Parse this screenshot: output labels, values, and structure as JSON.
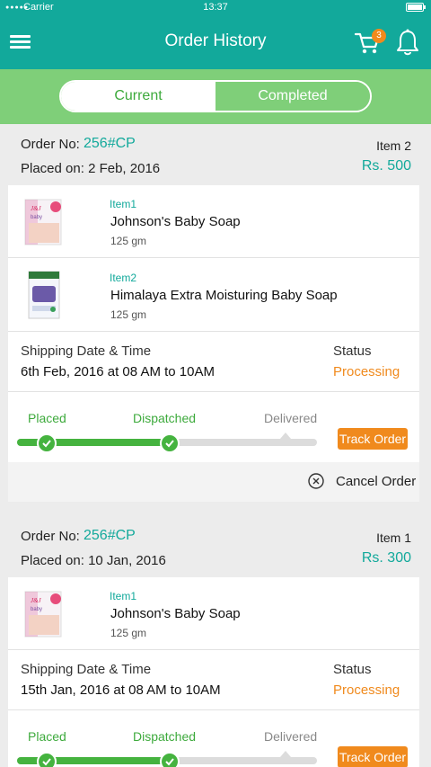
{
  "status_bar": {
    "carrier": "Carrier",
    "time": "13:37"
  },
  "app_bar": {
    "title": "Order History",
    "cart_count": "3"
  },
  "tabs": {
    "current": "Current",
    "completed": "Completed"
  },
  "colors": {
    "primary": "#12a99b",
    "green": "#45b33f",
    "orange": "#f08a1d",
    "tab_bg": "#7fcf79"
  },
  "labels": {
    "order_no": "Order No:",
    "placed_on": "Placed on:",
    "shipping": "Shipping Date & Time",
    "status": "Status",
    "track_order": "Track Order",
    "cancel_order": "Cancel Order",
    "step_placed": "Placed",
    "step_dispatched": "Dispatched",
    "step_delivered": "Delivered"
  },
  "orders": [
    {
      "order_no": "256#CP",
      "placed_date": "2 Feb, 2016",
      "item_count": "Item 2",
      "price": "Rs. 500",
      "items": [
        {
          "label": "Item1",
          "name": "Johnson's Baby Soap",
          "qty": "125 gm",
          "icon": "johnsons-baby-soap"
        },
        {
          "label": "Item2",
          "name": "Himalaya Extra Moisturing Baby Soap",
          "qty": "125 gm",
          "icon": "himalaya-baby-soap"
        }
      ],
      "shipping": "6th Feb, 2016 at 08 AM to 10AM",
      "status": "Processing",
      "steps_completed": 2
    },
    {
      "order_no": "256#CP",
      "placed_date": "10 Jan, 2016",
      "item_count": "Item 1",
      "price": "Rs. 300",
      "items": [
        {
          "label": "Item1",
          "name": "Johnson's Baby Soap",
          "qty": "125 gm",
          "icon": "johnsons-baby-soap"
        }
      ],
      "shipping": "15th Jan, 2016 at 08 AM to 10AM",
      "status": "Processing",
      "steps_completed": 2
    }
  ]
}
